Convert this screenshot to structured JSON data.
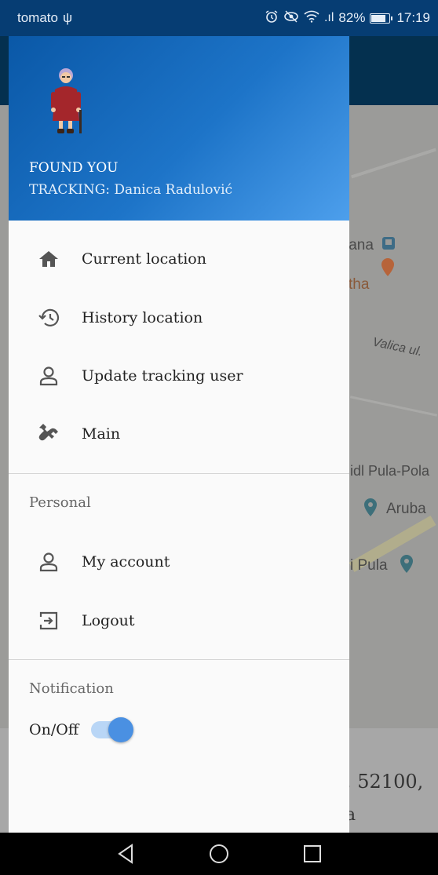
{
  "status_bar": {
    "carrier": "tomato",
    "usb_glyph": "ψ",
    "signal_glyph": ".ıl",
    "battery_percent": "82%",
    "battery_level": 0.82,
    "time": "17:19",
    "icons": [
      "usb-icon",
      "alarm-icon",
      "eye-icon",
      "wifi-icon",
      "signal-icon",
      "battery-icon"
    ]
  },
  "drawer": {
    "header": {
      "title": "FOUND YOU",
      "subtitle": "TRACKING: Danica Radulović",
      "background_colors": [
        "#0a58a7",
        "#1d74c8",
        "#4d9fec"
      ]
    },
    "menu_items": [
      {
        "label": "Current location",
        "icon": "home-icon"
      },
      {
        "label": "History location",
        "icon": "history-icon"
      },
      {
        "label": "Update tracking user",
        "icon": "person-icon"
      },
      {
        "label": "Main",
        "icon": "wrench-icon"
      }
    ],
    "personal": {
      "title": "Personal",
      "items": [
        {
          "label": "My account",
          "icon": "person-icon"
        },
        {
          "label": "Logout",
          "icon": "logout-icon"
        }
      ]
    },
    "notification": {
      "title": "Notification",
      "toggle_label": "On/Off",
      "toggle_on": true,
      "accent": "#4a90e2"
    }
  },
  "map": {
    "labels": [
      "jana",
      "tha",
      "Valica ul.",
      "idl Pula-Pola",
      "Aruba",
      "i Pula"
    ],
    "bottom_text": ", 52100,",
    "bottom_text2": "a"
  },
  "nav_bar": {
    "icons": [
      "back-icon",
      "home-circle-icon",
      "recents-icon"
    ]
  }
}
